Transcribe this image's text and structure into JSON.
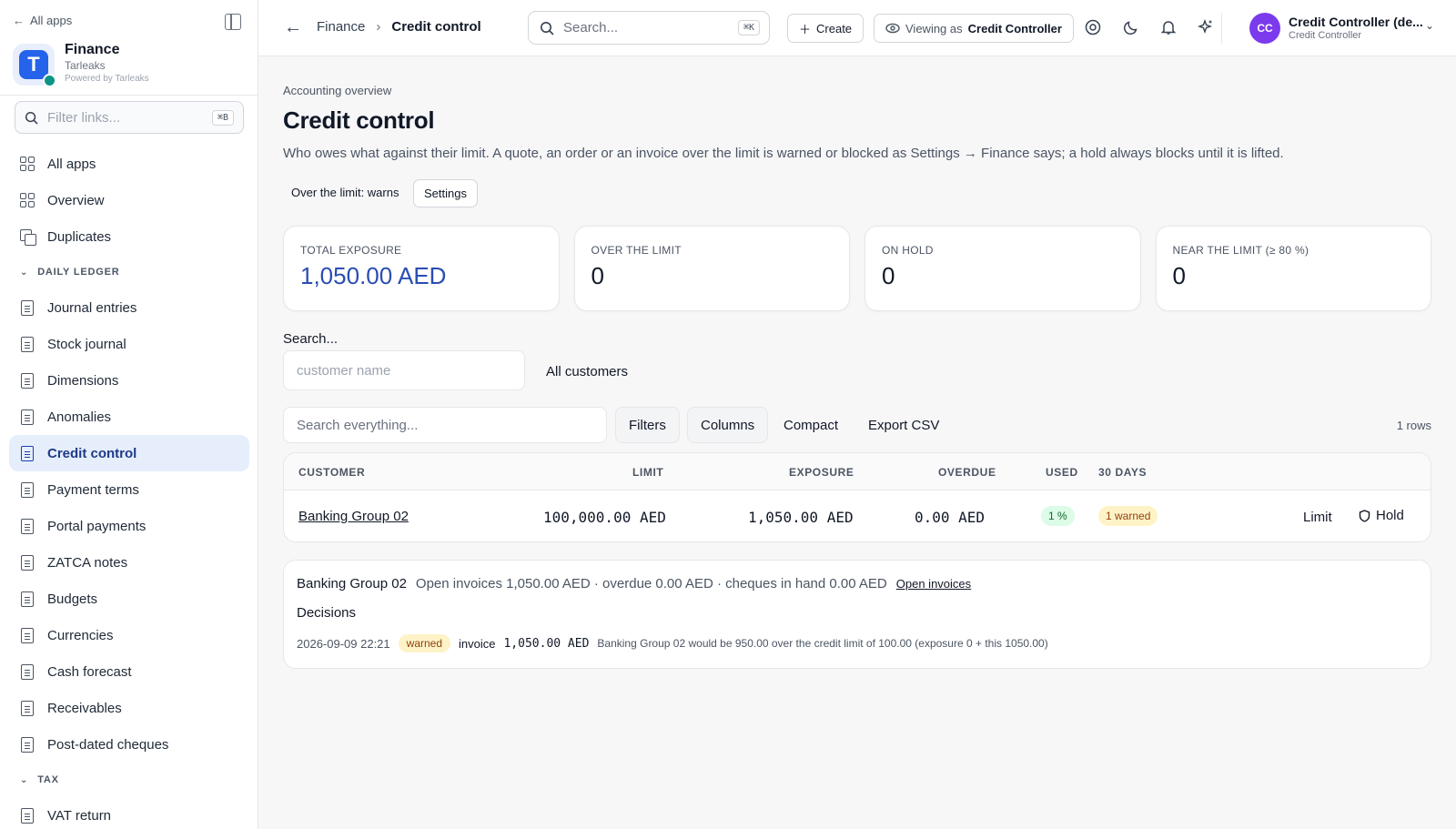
{
  "sidebar": {
    "all_apps_link": "All apps",
    "app_name": "Finance",
    "app_org": "Tarleaks",
    "app_powered": "Powered by Tarleaks",
    "logo_letter": "T",
    "filter_placeholder": "Filter links...",
    "filter_shortcut": "⌘B",
    "top_items": [
      {
        "label": "All apps",
        "icon": "grid-icon"
      },
      {
        "label": "Overview",
        "icon": "grid-icon"
      },
      {
        "label": "Duplicates",
        "icon": "duplicate-icon"
      }
    ],
    "section_daily_ledger": "DAILY LEDGER",
    "ledger_items": [
      {
        "label": "Journal entries",
        "icon": "document-icon"
      },
      {
        "label": "Stock journal",
        "icon": "document-icon"
      },
      {
        "label": "Dimensions",
        "icon": "document-icon"
      },
      {
        "label": "Anomalies",
        "icon": "document-icon"
      },
      {
        "label": "Credit control",
        "icon": "document-icon",
        "active": true
      },
      {
        "label": "Payment terms",
        "icon": "document-icon"
      },
      {
        "label": "Portal payments",
        "icon": "document-icon"
      },
      {
        "label": "ZATCA notes",
        "icon": "document-icon"
      },
      {
        "label": "Budgets",
        "icon": "document-icon"
      },
      {
        "label": "Currencies",
        "icon": "document-icon"
      },
      {
        "label": "Cash forecast",
        "icon": "document-icon"
      },
      {
        "label": "Receivables",
        "icon": "receipt-icon"
      },
      {
        "label": "Post-dated cheques",
        "icon": "clipboard-icon"
      }
    ],
    "section_tax": "TAX",
    "tax_items": [
      {
        "label": "VAT return",
        "icon": "dollar-doc-icon"
      }
    ]
  },
  "topbar": {
    "breadcrumb_parent": "Finance",
    "breadcrumb_current": "Credit control",
    "search_placeholder": "Search...",
    "search_shortcut": "⌘K",
    "create_label": "Create",
    "viewing_prefix": "Viewing as",
    "viewing_role": "Credit Controller",
    "user_initials": "CC",
    "user_name": "Credit Controller (de...",
    "user_role": "Credit Controller"
  },
  "page": {
    "eyebrow": "Accounting overview",
    "title": "Credit control",
    "description": "Who owes what against their limit. A quote, an order or an invoice over the limit is warned or blocked as Settings → Finance says; a hold always blocks until it is lifted.",
    "policy_text": "Over the limit: warns",
    "settings_label": "Settings"
  },
  "stats": [
    {
      "label": "TOTAL EXPOSURE",
      "value": "1,050.00 AED",
      "accent": true
    },
    {
      "label": "OVER THE LIMIT",
      "value": "0"
    },
    {
      "label": "ON HOLD",
      "value": "0"
    },
    {
      "label": "NEAR THE LIMIT (≥ 80 %)",
      "value": "0"
    }
  ],
  "filters": {
    "search_label": "Search...",
    "customer_placeholder": "customer name",
    "customer_scope": "All customers",
    "search_all_placeholder": "Search everything...",
    "filters_label": "Filters",
    "columns_label": "Columns",
    "compact_label": "Compact",
    "export_label": "Export CSV",
    "rows_count": "1 rows"
  },
  "table": {
    "headers": [
      "CUSTOMER",
      "LIMIT",
      "EXPOSURE",
      "OVERDUE",
      "USED",
      "30 DAYS"
    ],
    "rows": [
      {
        "customer": "Banking Group 02",
        "limit": "100,000.00 AED",
        "exposure": "1,050.00 AED",
        "overdue": "0.00 AED",
        "used": "1 %",
        "thirty_days": "1 warned",
        "limit_action": "Limit",
        "hold_action": "Hold"
      }
    ]
  },
  "detail": {
    "customer": "Banking Group 02",
    "summary": "Open invoices 1,050.00 AED · overdue 0.00 AED · cheques in hand 0.00 AED",
    "open_invoices_link": "Open invoices",
    "decisions_title": "Decisions",
    "decisions": [
      {
        "date": "2026-09-09 22:21",
        "status": "warned",
        "doc_type": "invoice",
        "amount": "1,050.00 AED",
        "message": "Banking Group 02 would be 950.00 over the credit limit of 100.00 (exposure 0 + this 1050.00)"
      }
    ]
  },
  "colors": {
    "accent": "#2a4db3",
    "active_nav_bg": "#e6eefb",
    "avatar": "#7c3aed",
    "warn_bg": "#fef3c7",
    "ok_bg": "#dcfce7"
  }
}
